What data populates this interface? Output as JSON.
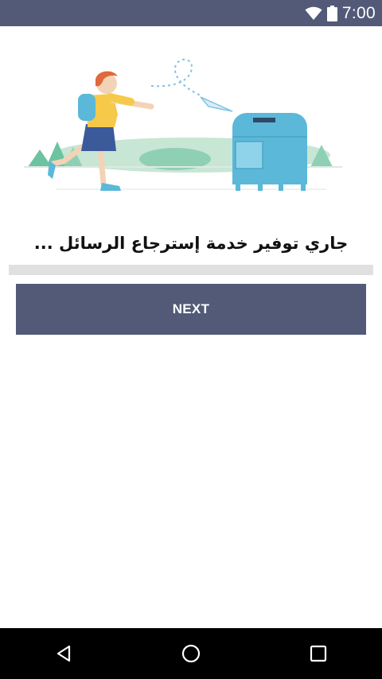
{
  "status_bar": {
    "time": "7:00",
    "icons": [
      "wifi-icon",
      "battery-icon"
    ]
  },
  "illustration": {
    "description_icon": "person-sending-paper-plane-to-mailbox-illustration"
  },
  "main": {
    "message": "جاري توفير خدمة إسترجاع الرسائل ...",
    "progress": 0,
    "next_label": "NEXT"
  },
  "nav_bar": {
    "icons": [
      "back-icon",
      "home-icon",
      "recents-icon"
    ]
  },
  "colors": {
    "primary": "#525a78",
    "progress_track": "#e0e0e0",
    "mailbox": "#5bb8d8",
    "nav_bar": "#000000"
  }
}
